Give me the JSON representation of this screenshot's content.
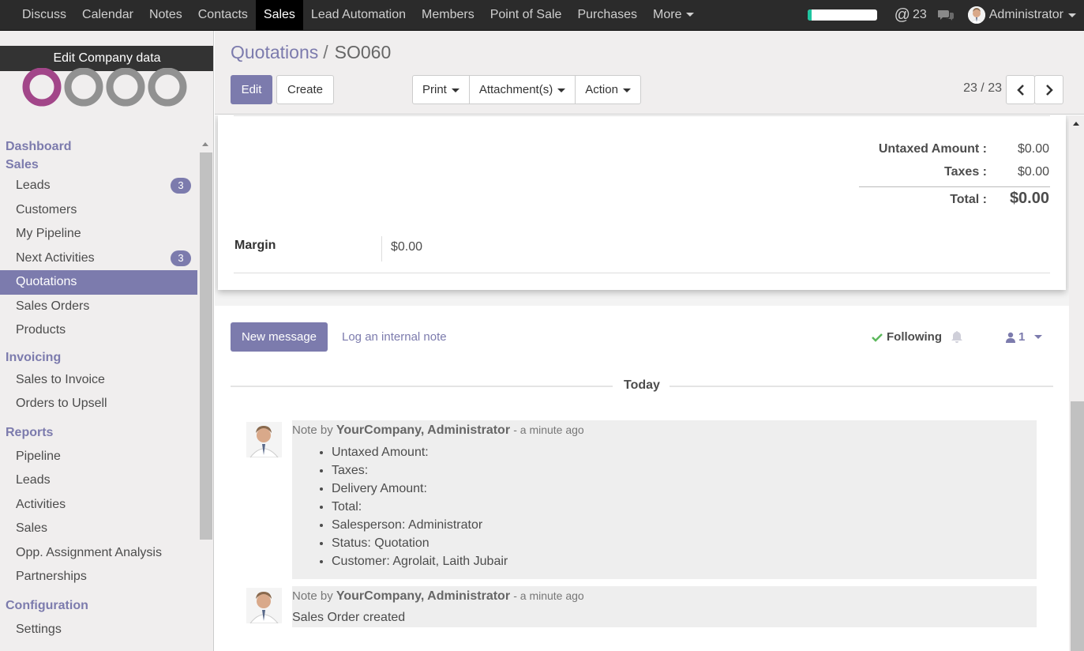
{
  "topbar": {
    "menu": [
      "Discuss",
      "Calendar",
      "Notes",
      "Contacts",
      "Sales",
      "Lead Automation",
      "Members",
      "Point of Sale",
      "Purchases",
      "More"
    ],
    "active": "Sales",
    "progress": 0.06,
    "mentions_count": "23",
    "user_name": "Administrator"
  },
  "sidebar": {
    "edit_company": "Edit Company data",
    "sections": [
      {
        "title": "Dashboard",
        "items": []
      },
      {
        "title": "Sales",
        "items": [
          {
            "label": "Leads",
            "badge": "3"
          },
          {
            "label": "Customers"
          },
          {
            "label": "My Pipeline"
          },
          {
            "label": "Next Activities",
            "badge": "3"
          },
          {
            "label": "Quotations",
            "active": true
          },
          {
            "label": "Sales Orders"
          },
          {
            "label": "Products"
          }
        ]
      },
      {
        "title": "Invoicing",
        "items": [
          {
            "label": "Sales to Invoice"
          },
          {
            "label": "Orders to Upsell"
          }
        ]
      },
      {
        "title": "Reports",
        "items": [
          {
            "label": "Pipeline"
          },
          {
            "label": "Leads"
          },
          {
            "label": "Activities"
          },
          {
            "label": "Sales"
          },
          {
            "label": "Opp. Assignment Analysis"
          },
          {
            "label": "Partnerships"
          }
        ]
      },
      {
        "title": "Configuration",
        "items": [
          {
            "label": "Settings"
          }
        ]
      }
    ]
  },
  "control_panel": {
    "breadcrumb_parent": "Quotations",
    "breadcrumb_current": "SO060",
    "edit_label": "Edit",
    "create_label": "Create",
    "print_label": "Print",
    "attachments_label": "Attachment(s)",
    "action_label": "Action",
    "pager": "23 / 23"
  },
  "form": {
    "untaxed_label": "Untaxed Amount :",
    "untaxed_value": "$0.00",
    "taxes_label": "Taxes :",
    "taxes_value": "$0.00",
    "total_label": "Total :",
    "total_value": "$0.00",
    "margin_label": "Margin",
    "margin_value": "$0.00"
  },
  "chatter": {
    "new_message_label": "New message",
    "log_note_label": "Log an internal note",
    "following_label": "Following",
    "followers_count": "1",
    "today_label": "Today",
    "messages": [
      {
        "prefix": "Note by",
        "author": "YourCompany, Administrator",
        "time": "- a minute ago",
        "lines": [
          "Untaxed Amount:",
          "Taxes:",
          "Delivery Amount:",
          "Total:",
          "Salesperson: Administrator",
          "Status: Quotation",
          "Customer: Agrolait, Laith Jubair"
        ]
      },
      {
        "prefix": "Note by",
        "author": "YourCompany, Administrator",
        "time": "- a minute ago",
        "body": "Sales Order created"
      }
    ]
  }
}
